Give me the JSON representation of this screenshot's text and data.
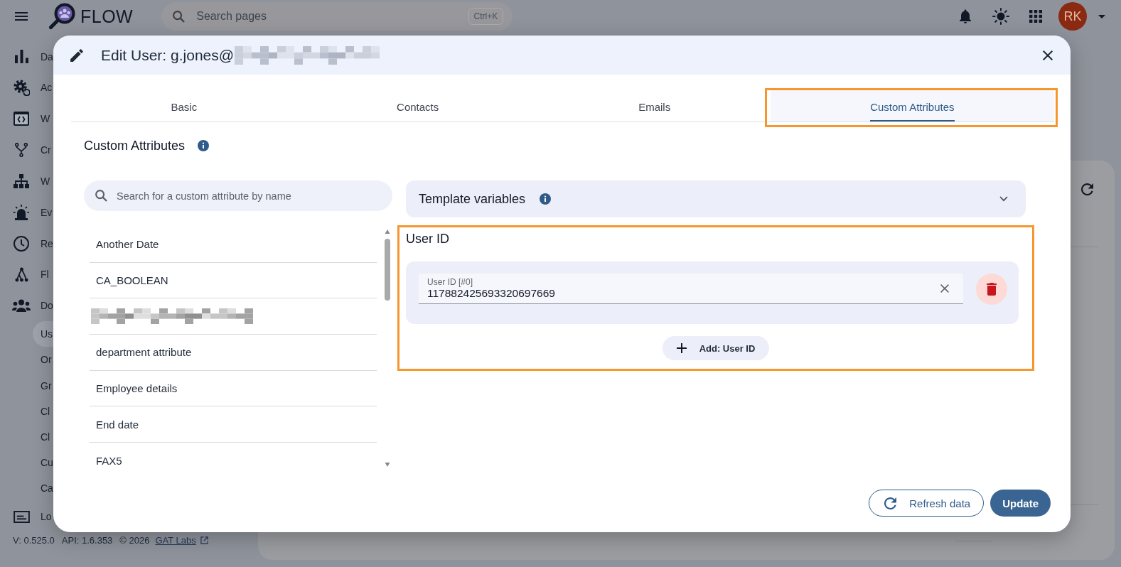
{
  "top_bar": {
    "app_name": "FLOW",
    "search": {
      "placeholder": "Search pages",
      "shortcut": "Ctrl+K"
    },
    "avatar": "RK"
  },
  "sidebar": {
    "items": [
      {
        "label": "Da",
        "selected": false
      },
      {
        "label": "Ac",
        "selected": false
      },
      {
        "label": "W",
        "selected": false
      },
      {
        "label": "Cr",
        "selected": false
      },
      {
        "label": "W",
        "selected": false
      },
      {
        "label": "Ev",
        "selected": false
      },
      {
        "label": "Re",
        "selected": false
      },
      {
        "label": "Fl",
        "selected": false
      },
      {
        "label": "Do",
        "selected": false,
        "children": [
          {
            "label": "Us",
            "selected": true
          },
          {
            "label": "Or",
            "selected": false
          },
          {
            "label": "Gr",
            "selected": false
          },
          {
            "label": "Cl",
            "selected": false
          },
          {
            "label": "Cl",
            "selected": false
          },
          {
            "label": "Cu",
            "selected": false
          },
          {
            "label": "Ca",
            "selected": false
          }
        ]
      },
      {
        "label": "Lo",
        "selected": false
      }
    ],
    "footer": {
      "version": "V: 0.525.0",
      "api": "API: 1.6.353",
      "copyright": "© 2026",
      "link": "GAT Labs"
    }
  },
  "dialog": {
    "title": "Edit User: g.jones@",
    "title_redacted": true,
    "tabs": [
      {
        "label": "Basic",
        "selected": false,
        "highlighted": false
      },
      {
        "label": "Contacts",
        "selected": false,
        "highlighted": false
      },
      {
        "label": "Emails",
        "selected": false,
        "highlighted": false
      },
      {
        "label": "Custom Attributes",
        "selected": true,
        "highlighted": true
      }
    ],
    "heading": "Custom Attributes",
    "attribute_search": {
      "placeholder": "Search for a custom attribute by name"
    },
    "attributes": [
      {
        "kind": "text",
        "label": "Another Date"
      },
      {
        "kind": "text",
        "label": "CA_BOOLEAN"
      },
      {
        "kind": "redacted"
      },
      {
        "kind": "text",
        "label": "department attribute"
      },
      {
        "kind": "text",
        "label": "Employee details"
      },
      {
        "kind": "text",
        "label": "End date"
      },
      {
        "kind": "text",
        "label": "FAX5"
      }
    ],
    "template_variables": {
      "title": "Template variables",
      "expanded": false
    },
    "attribute_panel": {
      "title": "User ID",
      "highlighted": true,
      "values": [
        {
          "label": "User ID [#0]",
          "value": "117882425693320697669"
        }
      ],
      "add_button": "Add: User ID"
    },
    "buttons": {
      "refresh": "Refresh data",
      "update": "Update"
    }
  }
}
